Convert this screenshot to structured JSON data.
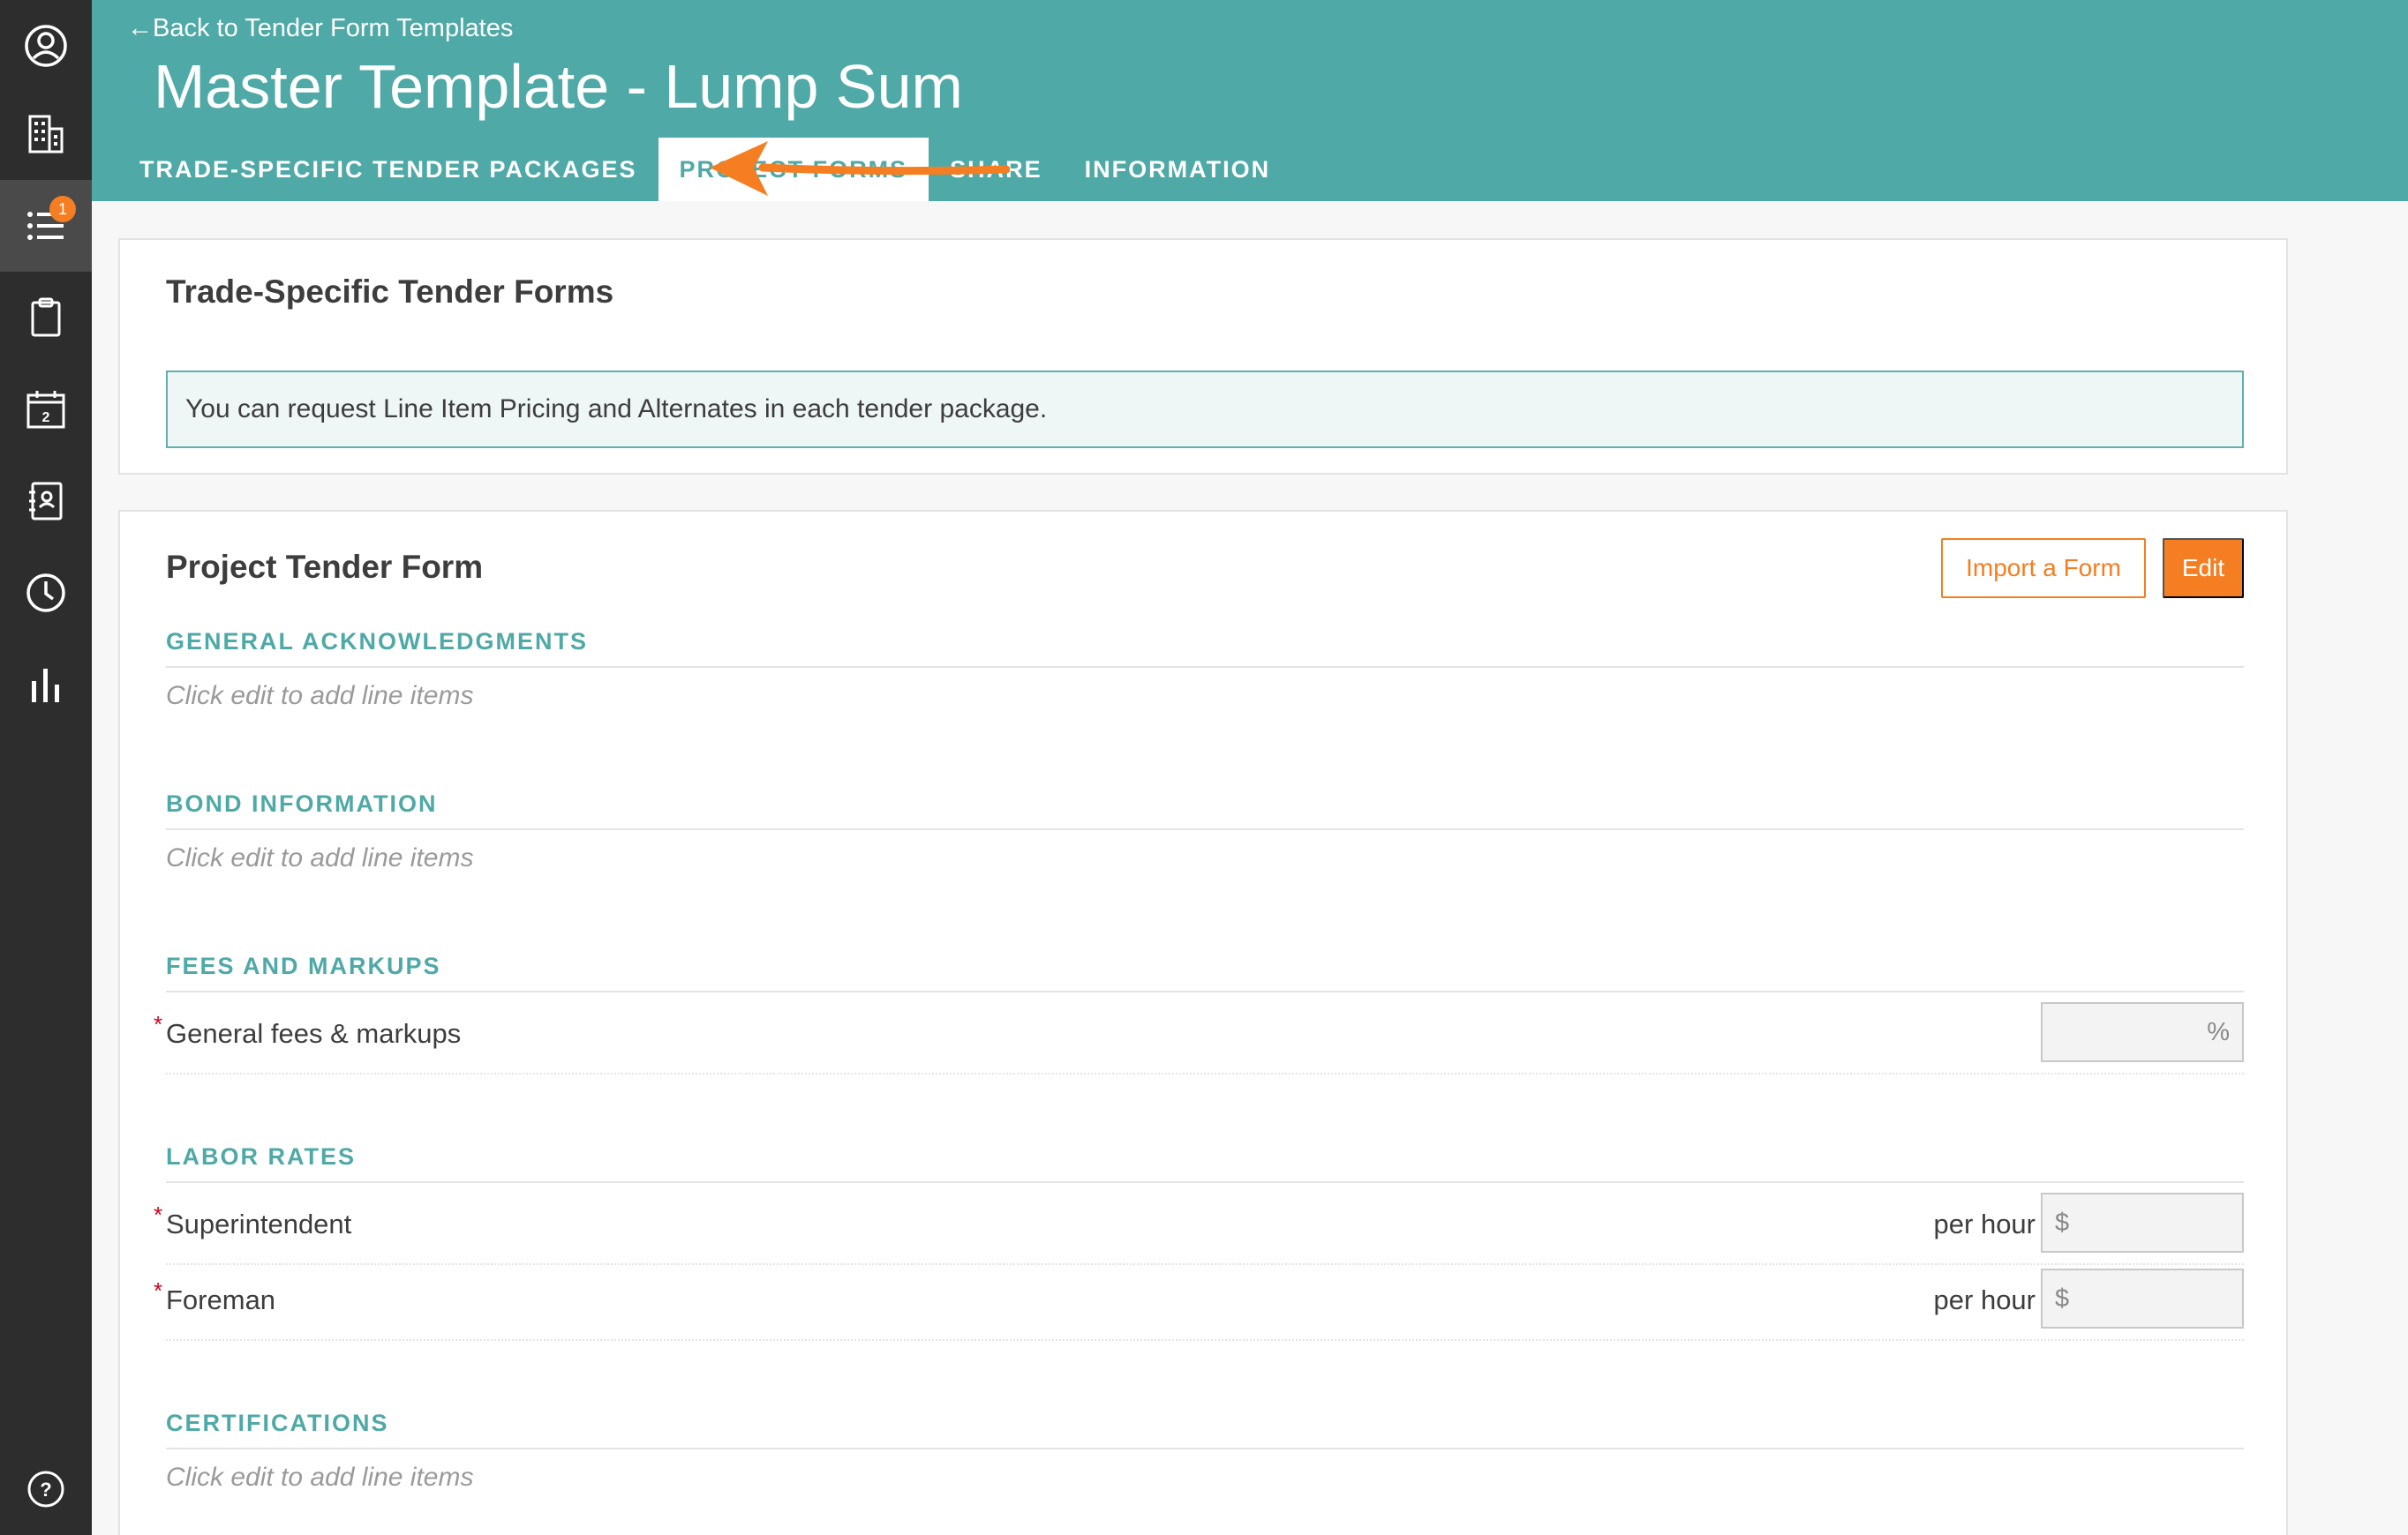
{
  "sidebar": {
    "items": [
      {
        "icon": "user-circle-icon"
      },
      {
        "icon": "building-icon"
      },
      {
        "icon": "list-icon",
        "badge": "1",
        "active": true
      },
      {
        "icon": "clipboard-icon"
      },
      {
        "icon": "calendar-icon",
        "calendar_day": "2"
      },
      {
        "icon": "address-book-icon"
      },
      {
        "icon": "clock-icon"
      },
      {
        "icon": "bar-chart-icon"
      },
      {
        "icon": "help-icon"
      }
    ]
  },
  "header": {
    "back_link": "←Back to Tender Form Templates",
    "title": "Master Template - Lump Sum",
    "tabs": [
      {
        "label": "TRADE-SPECIFIC TENDER PACKAGES"
      },
      {
        "label": "PROJECT FORMS",
        "active": true
      },
      {
        "label": "SHARE"
      },
      {
        "label": "INFORMATION"
      }
    ],
    "annotation_arrow_color": "#f47e21"
  },
  "trade_forms": {
    "title": "Trade-Specific Tender Forms",
    "info": "You can request Line Item Pricing and Alternates in each tender package."
  },
  "project_form": {
    "title": "Project Tender Form",
    "import_button": "Import a Form",
    "edit_button": "Edit",
    "sections": [
      {
        "heading": "GENERAL ACKNOWLEDGMENTS",
        "placeholder": "Click edit to add line items"
      },
      {
        "heading": "BOND INFORMATION",
        "placeholder": "Click edit to add line items"
      },
      {
        "heading": "FEES AND MARKUPS",
        "rows": [
          {
            "label": "General fees & markups",
            "required": "*",
            "unit": "%"
          }
        ]
      },
      {
        "heading": "LABOR RATES",
        "rows": [
          {
            "label": "Superintendent",
            "required": "*",
            "suffix": "per hour",
            "unit": "$"
          },
          {
            "label": "Foreman",
            "required": "*",
            "suffix": "per hour",
            "unit": "$"
          }
        ]
      },
      {
        "heading": "CERTIFICATIONS",
        "placeholder": "Click edit to add line items"
      }
    ]
  },
  "colors": {
    "teal": "#4fa9a6",
    "orange": "#f47e21",
    "rail": "#2d2d2d"
  }
}
